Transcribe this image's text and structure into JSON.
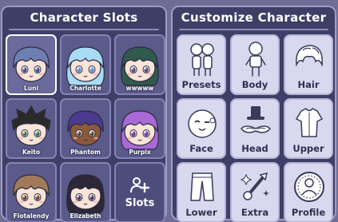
{
  "panels": {
    "slots_title": "Character Slots",
    "customize_title": "Customize Character"
  },
  "slots": [
    {
      "name": "Luni",
      "hair": "#6d7fb0",
      "eyes": "#3b4f8c",
      "selected": true
    },
    {
      "name": "Charlotte",
      "hair": "#a8dcf4",
      "eyes": "#5a8fd0",
      "selected": false
    },
    {
      "name": "wwwww",
      "hair": "#2f5a4d",
      "eyes": "#5b4a7a",
      "selected": false
    },
    {
      "name": "Keito",
      "hair": "#2a2a2a",
      "eyes": "#3e7a4a",
      "selected": false
    },
    {
      "name": "Phantom",
      "hair": "#4a3b8e",
      "eyes": "#5a4a2a",
      "selected": false
    },
    {
      "name": "Purplx",
      "hair": "#a86ad6",
      "eyes": "#6a3aa6",
      "selected": false
    }
  ],
  "slots_row3": [
    {
      "name": "Flotalendy",
      "hair": "#a07a5a",
      "eyes": "#6a4a30"
    },
    {
      "name": "Elizabeth",
      "hair": "#2c2838",
      "eyes": "#4a3a6a"
    }
  ],
  "add_slot": {
    "label": "Slots",
    "icon": "add-person-icon"
  },
  "customize": [
    {
      "label": "Presets",
      "icon": "presets-icon"
    },
    {
      "label": "Body",
      "icon": "body-icon"
    },
    {
      "label": "Hair",
      "icon": "hair-icon"
    },
    {
      "label": "Face",
      "icon": "face-icon"
    },
    {
      "label": "Head",
      "icon": "head-icon"
    },
    {
      "label": "Upper",
      "icon": "upper-icon"
    },
    {
      "label": "Lower",
      "icon": "lower-icon"
    },
    {
      "label": "Extra",
      "icon": "extra-icon"
    },
    {
      "label": "Profile",
      "icon": "profile-icon"
    }
  ],
  "colors": {
    "panel_bg": "#3e3f67",
    "panel_border": "#9f9cc6",
    "slot_bg": "#5a5a8b",
    "button_bg": "#d9d8ef",
    "icon_line": "#3a3a5a"
  }
}
